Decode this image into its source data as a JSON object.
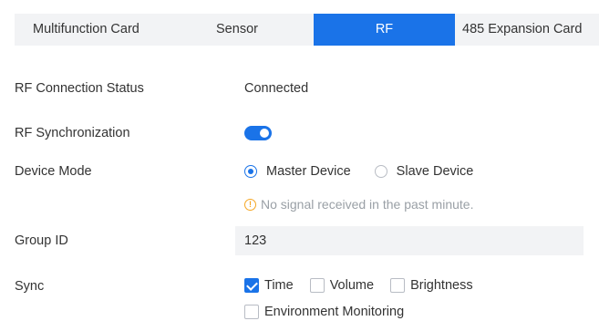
{
  "tabs": {
    "multifunction": "Multifunction Card",
    "sensor": "Sensor",
    "rf": "RF",
    "expansion_485": "485 Expansion Card"
  },
  "form": {
    "connection_status": {
      "label": "RF Connection Status",
      "value": "Connected"
    },
    "synchronization": {
      "label": "RF Synchronization",
      "enabled": true
    },
    "device_mode": {
      "label": "Device Mode",
      "options": [
        "Master Device",
        "Slave Device"
      ],
      "selected": "Master Device",
      "hint": "No signal received in the past minute."
    },
    "group_id": {
      "label": "Group ID",
      "value": "123"
    },
    "sync": {
      "label": "Sync",
      "options": [
        {
          "label": "Time",
          "checked": true
        },
        {
          "label": "Volume",
          "checked": false
        },
        {
          "label": "Brightness",
          "checked": false
        },
        {
          "label": "Environment Monitoring",
          "checked": false
        }
      ]
    }
  },
  "colors": {
    "accent": "#1a73e8",
    "warning": "#f5a623",
    "tab_bar_bg": "#f2f3f5"
  }
}
